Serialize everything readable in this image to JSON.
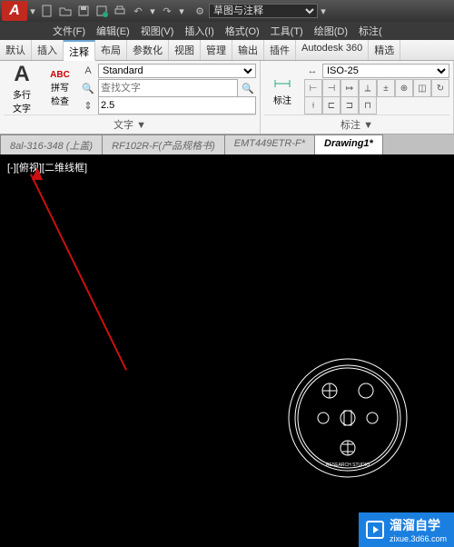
{
  "qat": {
    "logo": "A",
    "workspace": "草图与注释"
  },
  "menus": {
    "file": "文件(F)",
    "edit": "编辑(E)",
    "view": "视图(V)",
    "insert": "插入(I)",
    "format": "格式(O)",
    "tools": "工具(T)",
    "draw": "绘图(D)",
    "annotate": "标注("
  },
  "tabs": {
    "default": "默认",
    "insert": "插入",
    "annotate": "注释",
    "layout": "布局",
    "param": "参数化",
    "view": "视图",
    "manage": "管理",
    "output": "输出",
    "addins": "插件",
    "a360": "Autodesk 360",
    "featured": "精选"
  },
  "text_panel": {
    "btn_label": "多行\n文字",
    "spell": "拼写\n检查",
    "abc": "ABC",
    "style": "Standard",
    "find": "查找文字",
    "height": "2.5",
    "title": "文字 ▼"
  },
  "dim_panel": {
    "btn_label": "标注",
    "style": "ISO-25",
    "title": "标注 ▼"
  },
  "doc_tabs": {
    "t1": "8al-316-348 (上盖)",
    "t2": "RF102R-F(产品规格书)",
    "t3": "EMT449ETR-F*",
    "t4": "Drawing1*"
  },
  "viewport": "[-][俯视][二维线框]",
  "watermark": {
    "brand": "溜溜自学",
    "url": "zixue.3d66.com"
  }
}
